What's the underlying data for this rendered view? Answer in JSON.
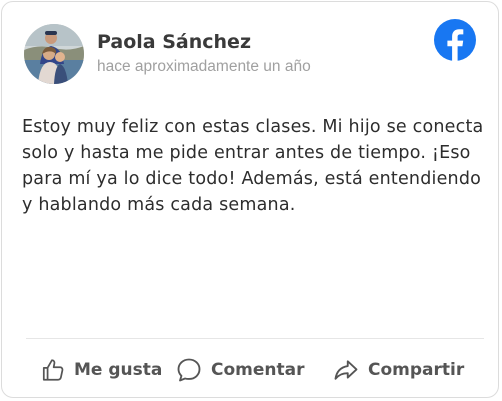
{
  "post": {
    "author": "Paola Sánchez",
    "timestamp": "hace aproximadamente un año",
    "text": "Estoy muy feliz con estas clases. Mi hijo se conecta solo y hasta me pide entrar antes de tiempo. ¡Eso para mí ya lo dice todo! Además, está entendiendo y hablando más cada semana.",
    "platform_icon": "facebook-icon",
    "brand_color": "#1877F2"
  },
  "actions": {
    "like_label": "Me gusta",
    "comment_label": "Comentar",
    "share_label": "Compartir"
  }
}
